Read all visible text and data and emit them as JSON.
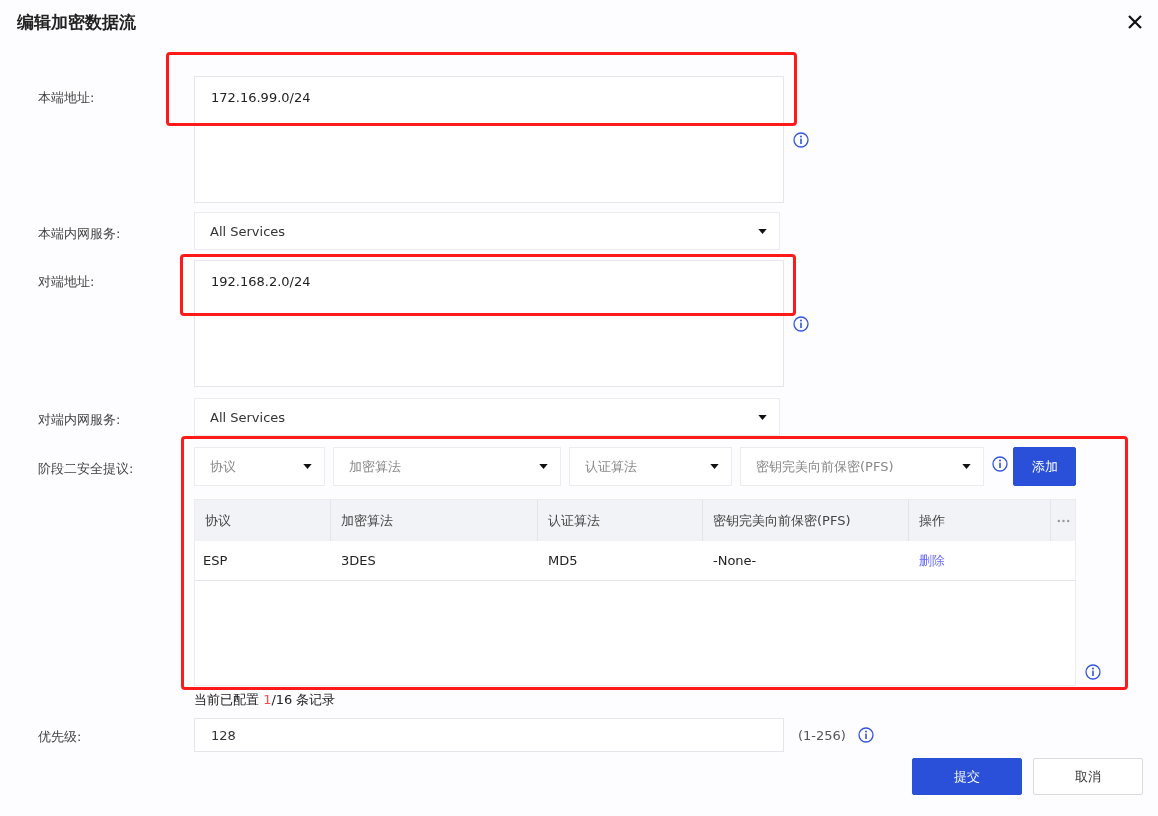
{
  "dialog": {
    "title": "编辑加密数据流"
  },
  "fields": [
    {
      "kind": "textarea",
      "label": "本端地址:",
      "value": "172.16.99.0/24",
      "highlighted": true
    },
    {
      "kind": "select",
      "label": "本端内网服务:",
      "value": "All Services",
      "highlighted": false
    },
    {
      "kind": "textarea",
      "label": "对端地址:",
      "value": "192.168.2.0/24",
      "highlighted": true
    },
    {
      "kind": "select",
      "label": "对端内网服务:",
      "value": "All Services",
      "highlighted": false
    }
  ],
  "phase2": {
    "label": "阶段二安全提议:",
    "highlighted": true,
    "selects": [
      {
        "placeholder": "协议"
      },
      {
        "placeholder": "加密算法"
      },
      {
        "placeholder": "认证算法"
      },
      {
        "placeholder": "密钥完美向前保密(PFS)"
      }
    ],
    "add_button": "添加",
    "table": {
      "columns": [
        "协议",
        "加密算法",
        "认证算法",
        "密钥完美向前保密(PFS)",
        "操作"
      ],
      "rows": [
        {
          "cells": [
            "ESP",
            "3DES",
            "MD5",
            "-None-"
          ],
          "action": "删除"
        }
      ]
    },
    "note": {
      "before": "当前已配置 ",
      "count": "1",
      "after": "/16 条记录"
    }
  },
  "priority": {
    "label": "优先级:",
    "value": "128",
    "range": "(1-256)"
  },
  "buttons": [
    {
      "label": "提交",
      "primary": true
    },
    {
      "label": "取消",
      "primary": false
    }
  ]
}
